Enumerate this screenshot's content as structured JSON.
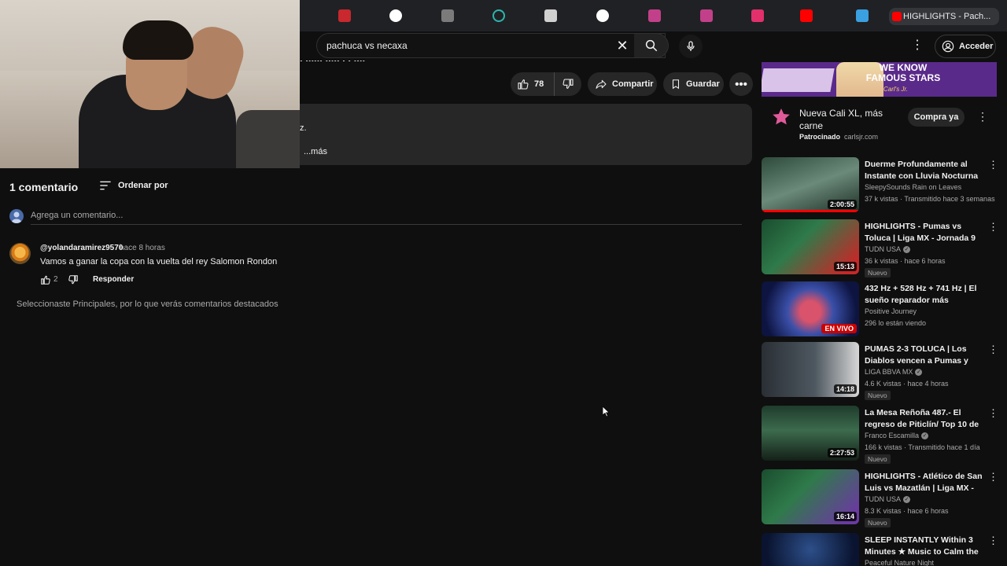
{
  "browser": {
    "active_tab_title": "HIGHLIGHTS - Pach..."
  },
  "masthead": {
    "search_value": "pachuca vs necaxa",
    "clear_glyph": "✕",
    "more_glyph": "⋮",
    "signin_label": "Acceder"
  },
  "video": {
    "title_fragment": ". ...... ..... . . ....",
    "likes": "78",
    "share_label": "Compartir",
    "save_label": "Guardar",
    "more_glyph": "•••",
    "description_fragment": "z.",
    "description_more": "...más"
  },
  "comments": {
    "count_label": "1 comentario",
    "sort_label": "Ordenar por",
    "add_placeholder": "Agrega un comentario...",
    "items": [
      {
        "author": "@yolandaramirez9570",
        "time": "hace 8 horas",
        "text": "Vamos a ganar la copa con la vuelta del rey Salomon Rondon",
        "likes": "2",
        "reply_label": "Responder"
      }
    ],
    "filter_note": "Seleccionaste Principales, por lo que verás comentarios destacados"
  },
  "sidebar": {
    "ad": {
      "banner_slogan": "WE KNOW FAMOUS STARS",
      "banner_brand": "Carl's Jr.",
      "title": "Nueva Cali XL, más carne",
      "sponsored": "Patrocinado",
      "domain": "carlsjr.com",
      "cta": "Compra ya",
      "menu_glyph": "⋮"
    },
    "recommendations": [
      {
        "title": "Duerme Profundamente al Instante con Lluvia Nocturna ...",
        "channel": "SleepySounds Rain on Leaves",
        "meta": "37 k vistas · Transmitido hace 3 semanas",
        "duration": "2:00:55",
        "badge": "",
        "verified": false
      },
      {
        "title": "HIGHLIGHTS - Pumas vs Toluca | Liga MX - Jornada 9 Clausura ...",
        "channel": "TUDN USA",
        "meta": "36 k vistas · hace 6 horas",
        "duration": "15:13",
        "badge": "Nuevo",
        "verified": true
      },
      {
        "title": "432 Hz + 528 Hz + 741 Hz | El sueño reparador más profund...",
        "channel": "Positive Journey",
        "meta": "296 lo están viendo",
        "live": "EN VIVO",
        "badge": "",
        "verified": false
      },
      {
        "title": "PUMAS 2-3 TOLUCA | Los Diablos vencen a Pumas y son ...",
        "channel": "LIGA BBVA MX",
        "meta": "4.6 K vistas · hace 4 horas",
        "duration": "14:18",
        "badge": "Nuevo",
        "verified": true
      },
      {
        "title": "La Mesa Reñoña 487.- El regreso de Piticlín/ Top 10 de ...",
        "channel": "Franco Escamilla",
        "meta": "166 k vistas · Transmitido hace 1 día",
        "duration": "2:27:53",
        "badge": "Nuevo",
        "verified": true
      },
      {
        "title": "HIGHLIGHTS - Atlético de San Luis vs Mazatlán | Liga MX - ...",
        "channel": "TUDN USA",
        "meta": "8.3 K vistas · hace 6 horas",
        "duration": "16:14",
        "badge": "Nuevo",
        "verified": true
      },
      {
        "title": "SLEEP INSTANTLY Within 3 Minutes ★ Music to Calm the ...",
        "channel": "Peaceful Nature Night",
        "meta": "",
        "duration": "",
        "badge": "",
        "verified": false
      }
    ]
  }
}
